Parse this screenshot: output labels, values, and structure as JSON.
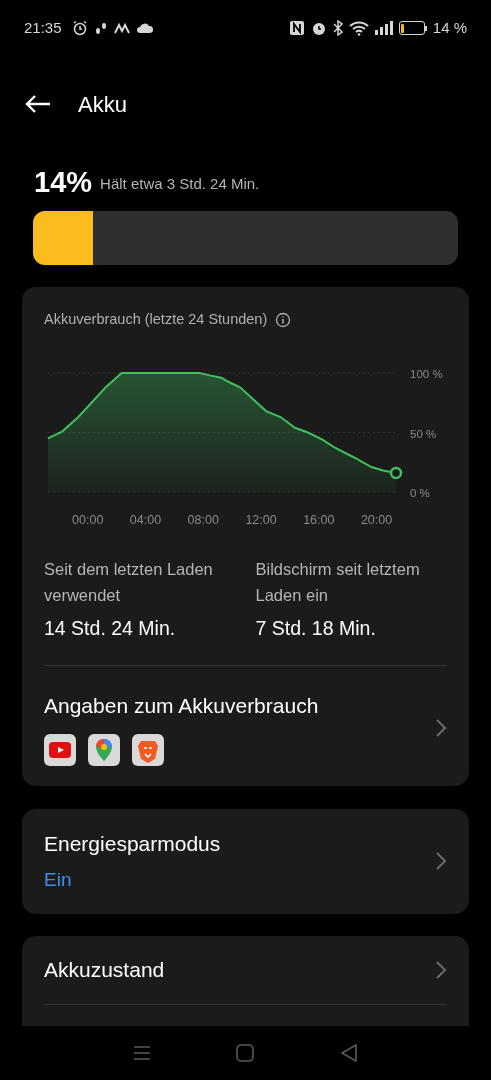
{
  "status_bar": {
    "time": "21:35",
    "battery_text": "14 %"
  },
  "header": {
    "title": "Akku"
  },
  "battery": {
    "percent": "14%",
    "estimate": "Hält etwa 3 Std. 24 Min.",
    "level": 0.14
  },
  "usage_card": {
    "title": "Akkuverbrauch (letzte 24 Stunden)",
    "chart_data": {
      "type": "area",
      "xlim": [
        -2.6,
        21.5
      ],
      "ylim": [
        0,
        100
      ],
      "xticks": [
        {
          "value": 0,
          "label": "00:00"
        },
        {
          "value": 4,
          "label": "04:00"
        },
        {
          "value": 8,
          "label": "08:00"
        },
        {
          "value": 12,
          "label": "12:00"
        },
        {
          "value": 16,
          "label": "16:00"
        },
        {
          "value": 20,
          "label": "20:00"
        }
      ],
      "yticks": [
        {
          "value": 100,
          "label": "100 %"
        },
        {
          "value": 50,
          "label": "50 %"
        },
        {
          "value": 0,
          "label": "0 %"
        }
      ],
      "x": [
        -2.6,
        -1.6,
        -0.5,
        1.4,
        2.5,
        7.9,
        8.6,
        9.4,
        10,
        10.7,
        11.6,
        12.5,
        13.5,
        14.5,
        15.4,
        16.4,
        17.3,
        18.6,
        19.8,
        20.6,
        21.5
      ],
      "series": [
        {
          "color": "#3fbf5f",
          "values": [
            45,
            51,
            63,
            88,
            100,
            100,
            98,
            96,
            92,
            88,
            78,
            68,
            63,
            54,
            50,
            44,
            37,
            29,
            21,
            18,
            16
          ]
        }
      ]
    },
    "stats": [
      {
        "label": "Seit dem letzten Laden verwendet",
        "value": "14 Std. 24 Min."
      },
      {
        "label": "Bildschirm seit letztem Laden ein",
        "value": "7 Std. 18 Min."
      }
    ],
    "details": {
      "title": "Angaben zum Akkuverbrauch",
      "apps": [
        {
          "kind": "video"
        },
        {
          "kind": "maps"
        },
        {
          "kind": "browser"
        }
      ]
    }
  },
  "power_saving": {
    "title": "Energiesparmodus",
    "value": "Ein"
  },
  "battery_health": {
    "title": "Akkuzustand"
  }
}
